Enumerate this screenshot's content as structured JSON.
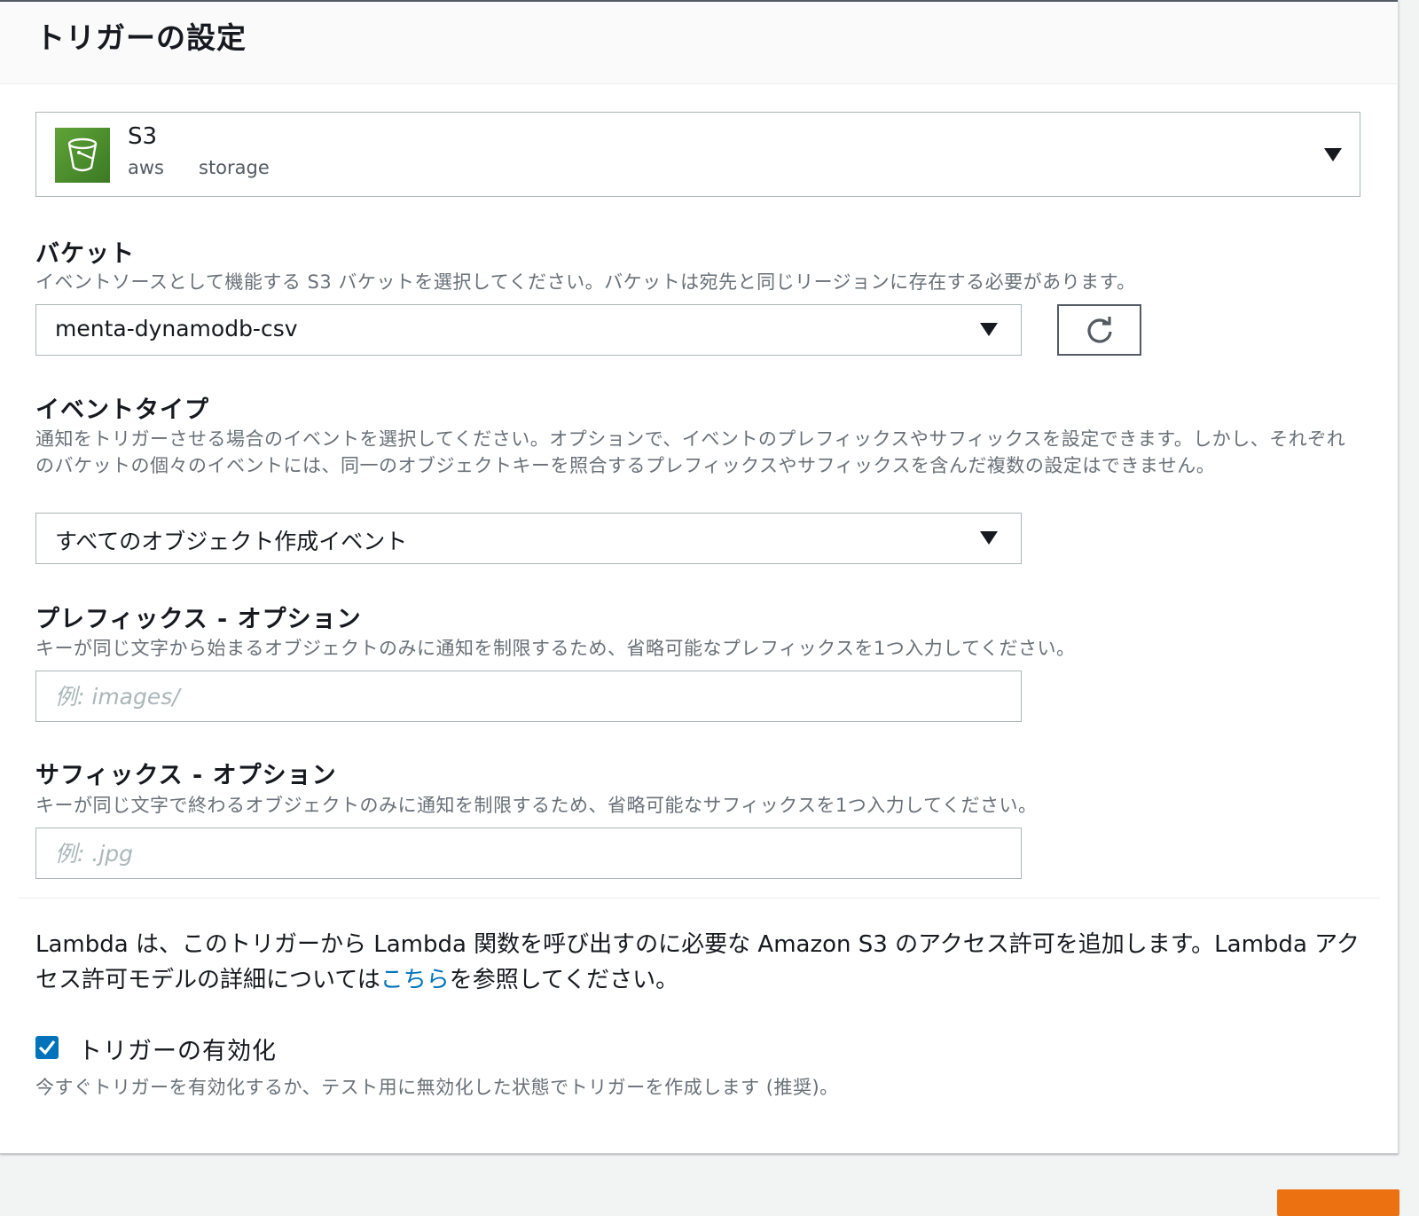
{
  "panel": {
    "title": "トリガーの設定"
  },
  "source": {
    "name": "S3",
    "tags": [
      "aws",
      "storage"
    ]
  },
  "bucket": {
    "label": "バケット",
    "description": "イベントソースとして機能する S3 バケットを選択してください。バケットは宛先と同じリージョンに存在する必要があります。",
    "value": "menta-dynamodb-csv"
  },
  "event_type": {
    "label": "イベントタイプ",
    "description": "通知をトリガーさせる場合のイベントを選択してください。オプションで、イベントのプレフィックスやサフィックスを設定できます。しかし、それぞれのバケットの個々のイベントには、同一のオブジェクトキーを照合するプレフィックスやサフィックスを含んだ複数の設定はできません。",
    "value": "すべてのオブジェクト作成イベント"
  },
  "prefix": {
    "label": "プレフィックス - オプション",
    "description": "キーが同じ文字から始まるオブジェクトのみに通知を制限するため、省略可能なプレフィックスを1つ入力してください。",
    "placeholder": "例: images/"
  },
  "suffix": {
    "label": "サフィックス - オプション",
    "description": "キーが同じ文字で終わるオブジェクトのみに通知を制限するため、省略可能なサフィックスを1つ入力してください。",
    "placeholder": "例: .jpg"
  },
  "info": {
    "text_before": "Lambda は、このトリガーから Lambda 関数を呼び出すのに必要な Amazon S3 のアクセス許可を追加します。Lambda アクセス許可モデルの詳細については",
    "link": "こちら",
    "text_after": "を参照してください。"
  },
  "enable_trigger": {
    "label": "トリガーの有効化",
    "checked": true,
    "description": "今すぐトリガーを有効化するか、テスト用に無効化した状態でトリガーを作成します (推奨)。"
  },
  "colors": {
    "accent": "#0073bb",
    "primary_button": "#ec7211",
    "s3_icon": "#3b7a24"
  },
  "icons": {
    "source": "s3-bucket-icon",
    "dropdown": "caret-down-icon",
    "refresh": "refresh-icon",
    "checkbox": "checkmark-icon"
  }
}
